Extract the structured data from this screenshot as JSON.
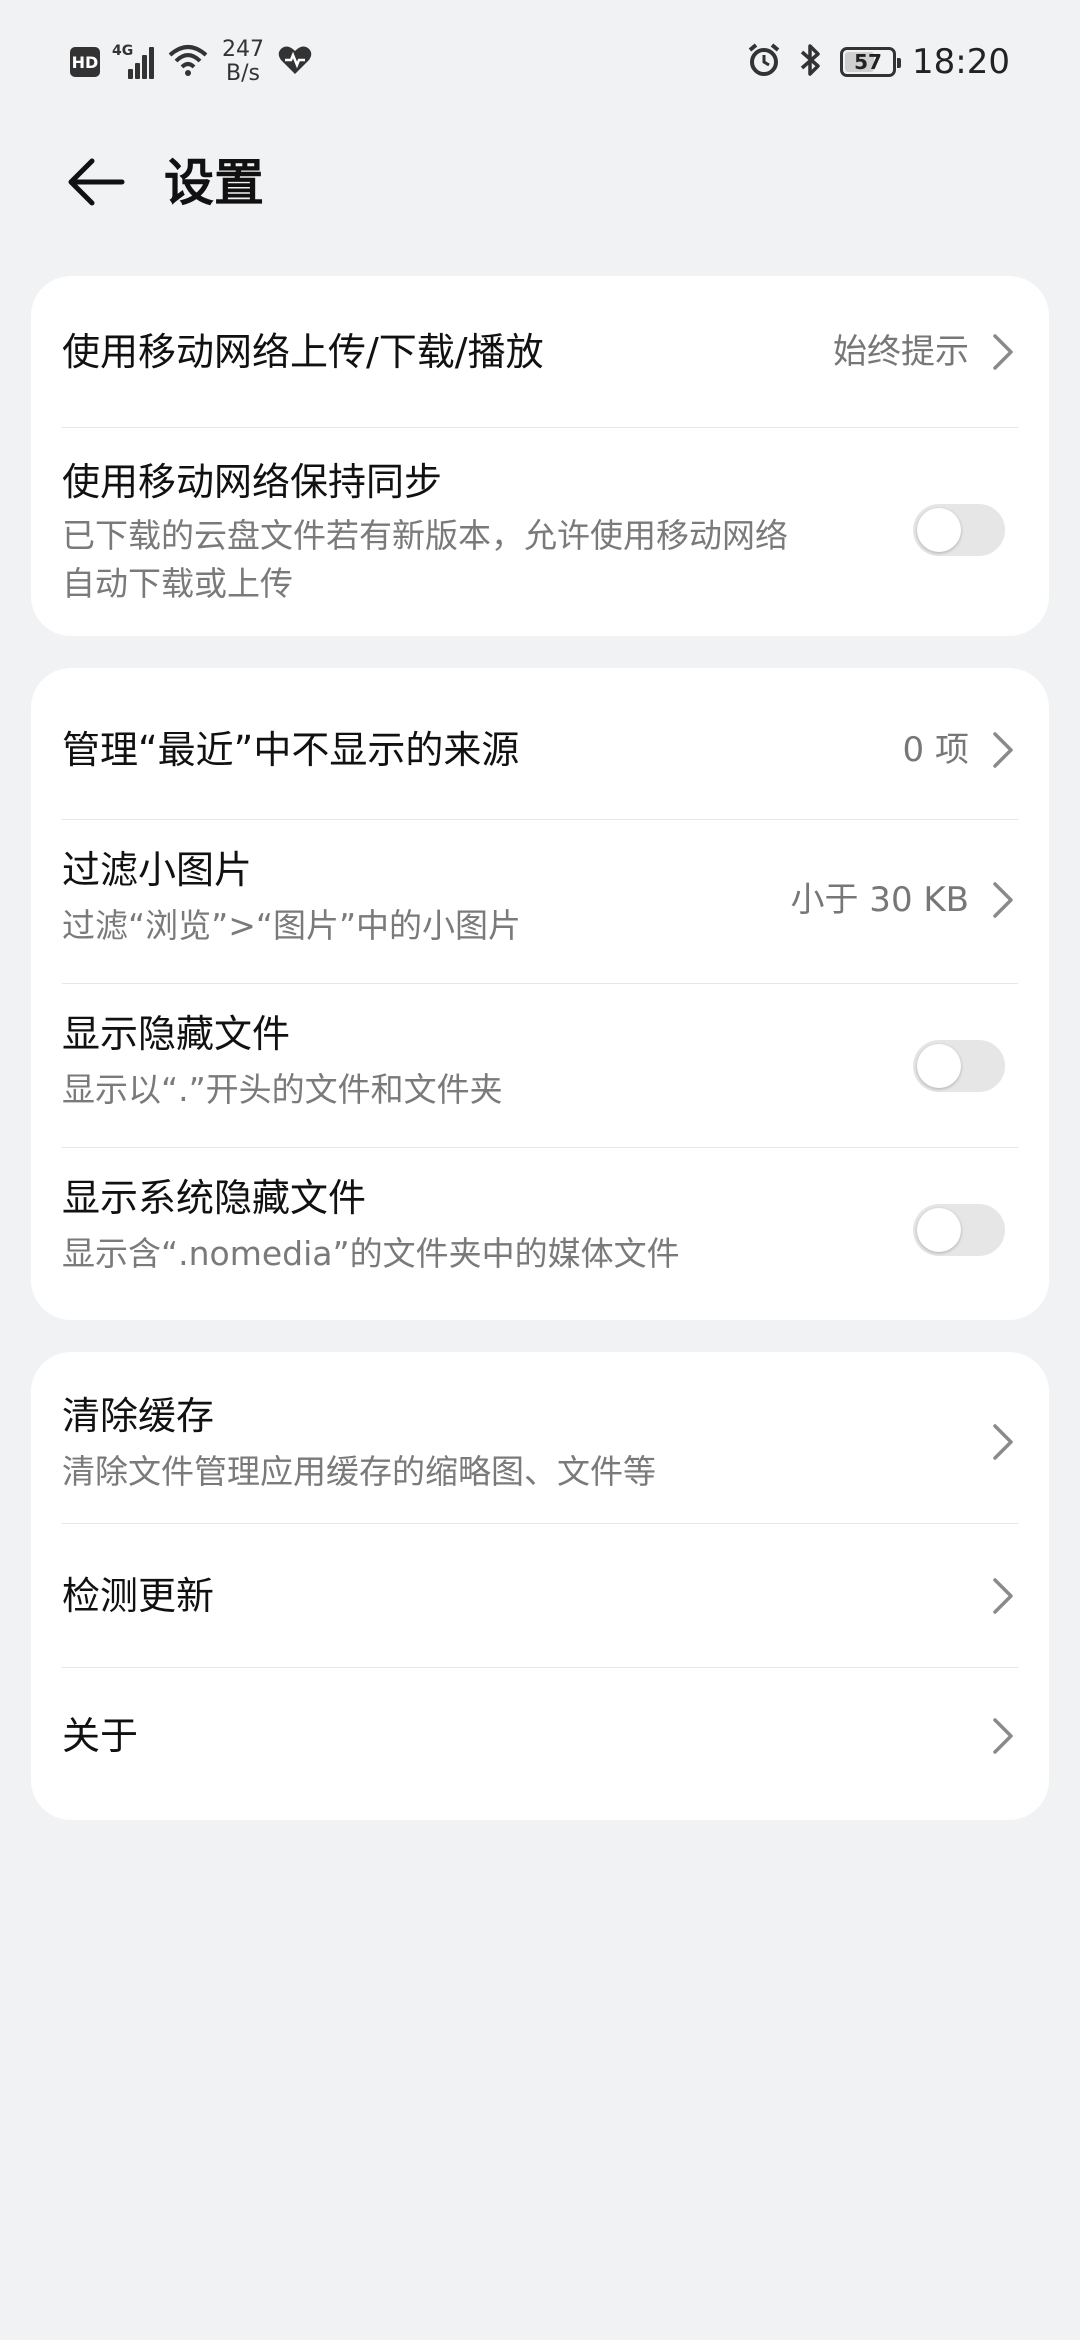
{
  "status_bar": {
    "hd": "HD",
    "network_type": "4G",
    "speed_value": "247",
    "speed_unit": "B/s",
    "battery": "57",
    "time": "18:20"
  },
  "header": {
    "title": "设置"
  },
  "section1": {
    "mobile_upload": {
      "title": "使用移动网络上传/下载/播放",
      "value": "始终提示"
    },
    "mobile_sync": {
      "title": "使用移动网络保持同步",
      "subtitle_line1": "已下载的云盘文件若有新版本，允许使用移动网络",
      "subtitle_line2": "自动下载或上传",
      "enabled": false
    }
  },
  "section2": {
    "recent_sources": {
      "title": "管理“最近”中不显示的来源",
      "value": "0 项"
    },
    "filter_small": {
      "title": "过滤小图片",
      "subtitle": "过滤“浏览”>“图片”中的小图片",
      "value": "小于 30 KB"
    },
    "show_hidden": {
      "title": "显示隐藏文件",
      "subtitle": "显示以“.”开头的文件和文件夹",
      "enabled": false
    },
    "show_system_hidden": {
      "title": "显示系统隐藏文件",
      "subtitle": "显示含“.nomedia”的文件夹中的媒体文件",
      "enabled": false
    }
  },
  "section3": {
    "clear_cache": {
      "title": "清除缓存",
      "subtitle": "清除文件管理应用缓存的缩略图、文件等"
    },
    "check_update": {
      "title": "检测更新"
    },
    "about": {
      "title": "关于"
    }
  },
  "icons": {
    "back": "arrow-left-icon",
    "chevron": "chevron-right-icon",
    "alarm": "alarm-icon",
    "bluetooth": "bluetooth-icon",
    "wifi": "wifi-icon",
    "health": "heart-icon"
  },
  "colors": {
    "background": "#f1f2f4",
    "card": "#ffffff",
    "toggle_off": "#e6e6e6",
    "secondary_text": "#7a7a7a"
  }
}
